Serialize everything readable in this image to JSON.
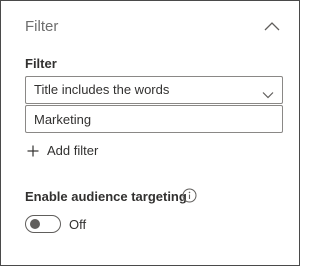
{
  "section": {
    "title": "Filter",
    "collapse_icon": "chevron-up-icon"
  },
  "filter": {
    "label": "Filter",
    "type_selected": "Title includes the words",
    "type_dropdown_icon": "chevron-down-icon",
    "keyword_value": "Marketing",
    "add_filter_label": "Add filter",
    "add_filter_icon": "plus-icon"
  },
  "audience_targeting": {
    "label": "Enable audience targeting",
    "info_icon": "info-icon",
    "toggle_enabled": false,
    "toggle_state_label": "Off"
  },
  "colors": {
    "border": "#8a8886",
    "text": "#323130",
    "muted": "#6e6e6e"
  }
}
